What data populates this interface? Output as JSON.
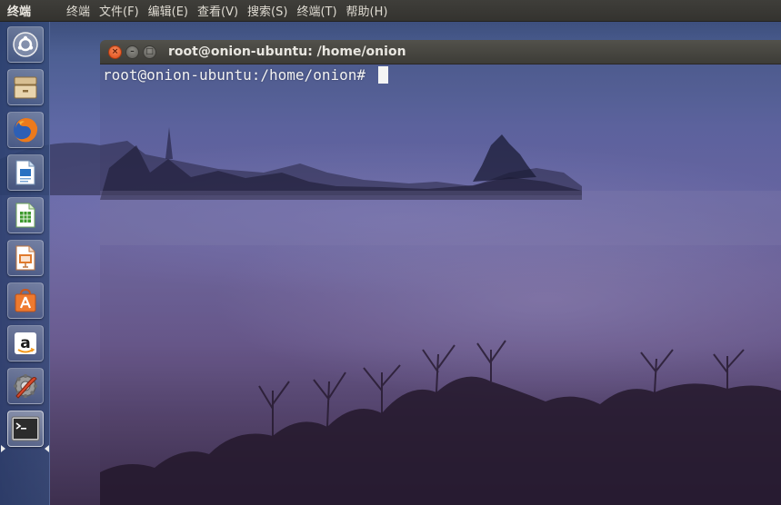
{
  "top_panel": {
    "app_name": "终端",
    "menu": [
      "终端",
      "文件(F)",
      "编辑(E)",
      "查看(V)",
      "搜索(S)",
      "终端(T)",
      "帮助(H)"
    ]
  },
  "launcher": {
    "items": [
      {
        "name": "dash-home-icon"
      },
      {
        "name": "files-icon"
      },
      {
        "name": "firefox-icon"
      },
      {
        "name": "libreoffice-writer-icon"
      },
      {
        "name": "libreoffice-calc-icon"
      },
      {
        "name": "libreoffice-impress-icon"
      },
      {
        "name": "ubuntu-software-center-icon"
      },
      {
        "name": "amazon-icon"
      },
      {
        "name": "system-settings-icon"
      },
      {
        "name": "terminal-icon",
        "active": true
      }
    ]
  },
  "terminal": {
    "title": "root@onion-ubuntu: /home/onion",
    "buttons": {
      "close": "×",
      "minimize": "–",
      "maximize": "□"
    },
    "prompt": "root@onion-ubuntu:/home/onion# "
  },
  "colors": {
    "panel_bg": "#3c3b37",
    "close_button": "#e95420",
    "terminal_text": "#f2f2f2"
  }
}
